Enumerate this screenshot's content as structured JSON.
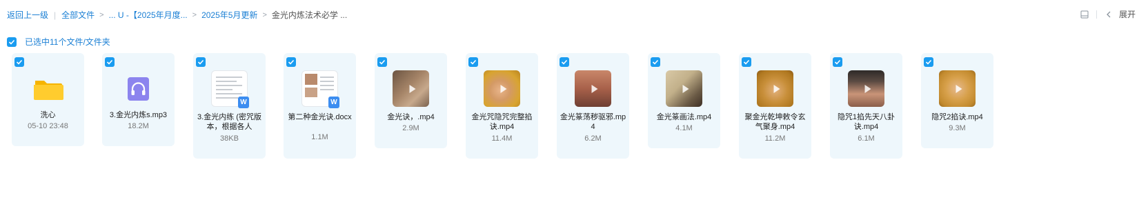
{
  "breadcrumb": {
    "back": "返回上一级",
    "items": [
      "全部文件",
      "... U -【2025年月度...",
      "2025年5月更新",
      "金光内炼法术必学 ..."
    ]
  },
  "toolbar": {
    "expand_label": "展开"
  },
  "selection": {
    "text": "已选中11个文件/文件夹"
  },
  "files": [
    {
      "name": "洗心",
      "meta": "05-10 23:48",
      "kind": "folder"
    },
    {
      "name": "3.金光内炼s.mp3",
      "meta": "18.2M",
      "kind": "audio"
    },
    {
      "name": "3.金光内练 (密咒版本，根据各人",
      "meta": "38KB",
      "kind": "doc"
    },
    {
      "name": "第二种金光诀.docx",
      "meta": "1.1M",
      "kind": "doc"
    },
    {
      "name": "金光诀，.mp4",
      "meta": "2.9M",
      "kind": "video"
    },
    {
      "name": "金光咒隐咒完整掐诀.mp4",
      "meta": "11.4M",
      "kind": "video"
    },
    {
      "name": "金光篆荡秽驱邪.mp4",
      "meta": "6.2M",
      "kind": "video"
    },
    {
      "name": "金光篆画法.mp4",
      "meta": "4.1M",
      "kind": "video"
    },
    {
      "name": "聚金光乾坤敕令玄气聚身.mp4",
      "meta": "11.2M",
      "kind": "video"
    },
    {
      "name": "隐咒1掐先天八卦诀.mp4",
      "meta": "6.1M",
      "kind": "video"
    },
    {
      "name": "隐咒2掐诀.mp4",
      "meta": "9.3M",
      "kind": "video"
    }
  ],
  "colors": {
    "accent": "#1a9cf0",
    "link": "#1a7fd4",
    "card_bg": "#eef7fc"
  },
  "icons": {
    "folder": "folder-icon",
    "audio": "headphones-icon",
    "doc": "wps-doc-icon",
    "video": "play-icon",
    "checkbox": "check-icon"
  }
}
